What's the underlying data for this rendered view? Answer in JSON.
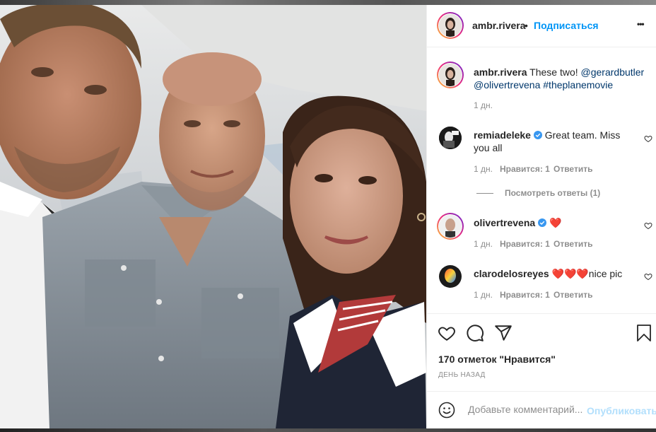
{
  "post": {
    "author": "ambr.rivera",
    "separator": "•",
    "follow_label": "Подписаться",
    "more_label": "•••",
    "caption": {
      "username": "ambr.rivera",
      "text_lead": "These two!",
      "mention1": "@gerardbutler",
      "mention2": "@olivertrevena",
      "hashtag": "#theplanemovie",
      "time": "1 дн."
    },
    "comments": [
      {
        "username": "remiadeleke",
        "verified": true,
        "text": "Great team. Miss you all",
        "time": "1 дн.",
        "likes": "Нравится: 1",
        "reply": "Ответить"
      },
      {
        "username": "olivertrevena",
        "verified": true,
        "text": "❤️",
        "time": "1 дн.",
        "likes": "Нравится: 1",
        "reply": "Ответить"
      },
      {
        "username": "clarodelosreyes",
        "verified": false,
        "text": "❤️❤️❤️nice pic",
        "time": "1 дн.",
        "likes": "Нравится: 1",
        "reply": "Ответить"
      }
    ],
    "view_replies": "Посмотреть ответы (1)",
    "likes_count": "170 отметок \"Нравится\"",
    "posted_ago": "ДЕНЬ НАЗАД",
    "comment_placeholder": "Добавьте комментарий...",
    "publish_label": "Опубликовать"
  },
  "colors": {
    "link": "#00376b",
    "follow": "#0095f6",
    "muted": "#8e8e8e",
    "heart": "#ed4956",
    "verified": "#3897f0"
  }
}
